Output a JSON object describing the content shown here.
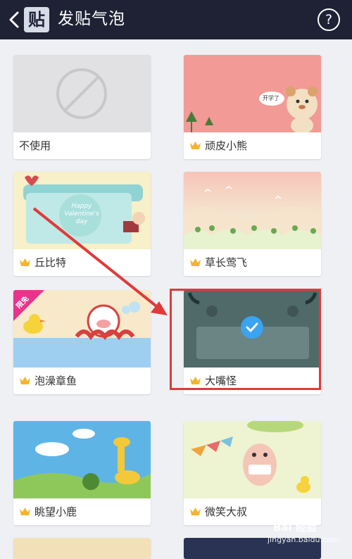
{
  "header": {
    "logo_text": "贴",
    "title": "发贴气泡",
    "help_label": "?"
  },
  "cards": [
    {
      "label": "不使用",
      "premium": false
    },
    {
      "label": "顽皮小熊",
      "premium": true,
      "thumb_text": "开学了"
    },
    {
      "label": "丘比特",
      "premium": true,
      "thumb_text": "Happy Valentine's day"
    },
    {
      "label": "草长莺飞",
      "premium": true
    },
    {
      "label": "泡澡章鱼",
      "premium": true,
      "badge": "限免"
    },
    {
      "label": "大嘴怪",
      "premium": true,
      "selected": true
    },
    {
      "label": "眺望小鹿",
      "premium": true
    },
    {
      "label": "微笑大叔",
      "premium": true
    }
  ],
  "watermark": {
    "line1": "Bai 经验",
    "line2": "jingyan.baidu.com"
  },
  "colors": {
    "header_bg": "#1f2235",
    "highlight": "#e03a3a",
    "check": "#3aa3f2",
    "crown": "#f3b52b"
  }
}
